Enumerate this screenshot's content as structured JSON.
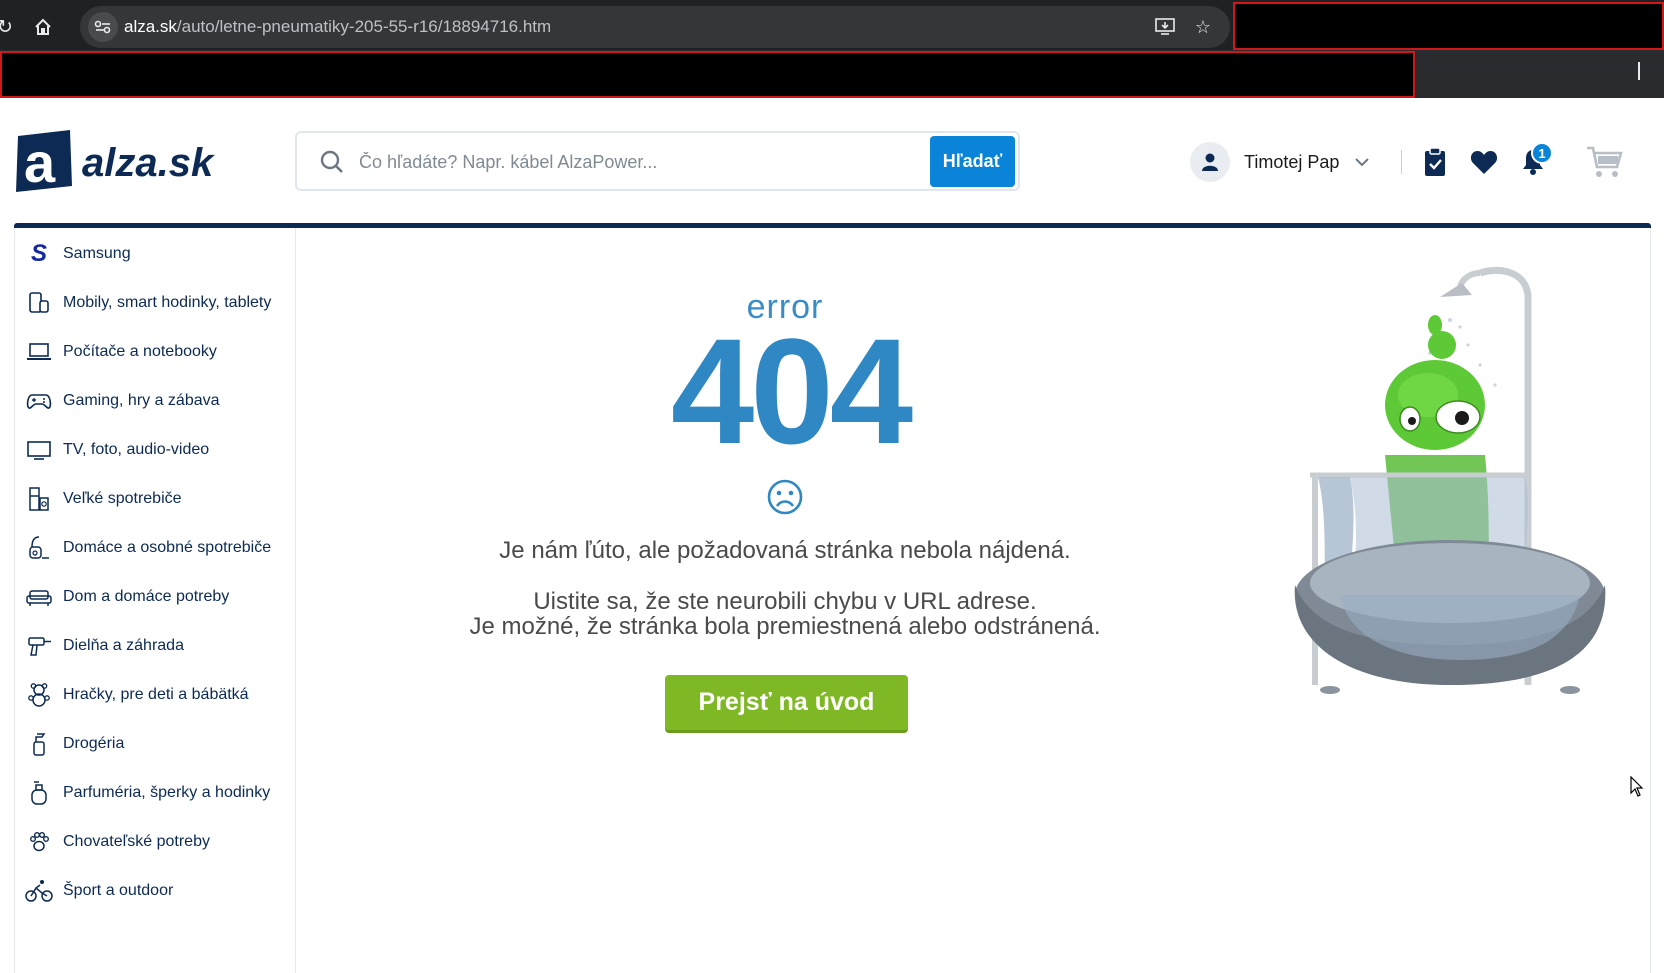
{
  "browser": {
    "url_domain": "alza.sk",
    "url_path": "/auto/letne-pneumatiky-205-55-r16/18894716.htm"
  },
  "header": {
    "logo_text": "alza.sk",
    "search_placeholder": "Čo hľadáte? Napr. kábel AlzaPower...",
    "search_button": "Hľadať",
    "user_name": "Timotej Pap",
    "notifications_count": "1"
  },
  "sidebar": {
    "items": [
      {
        "label": "Samsung",
        "icon": "samsung-icon"
      },
      {
        "label": "Mobily, smart hodinky, tablety",
        "icon": "phone-icon"
      },
      {
        "label": "Počítače a notebooky",
        "icon": "laptop-icon"
      },
      {
        "label": "Gaming, hry a zábava",
        "icon": "gamepad-icon"
      },
      {
        "label": "TV, foto, audio-video",
        "icon": "tv-icon"
      },
      {
        "label": "Veľké spotrebiče",
        "icon": "fridge-icon"
      },
      {
        "label": "Domáce a osobné spotrebiče",
        "icon": "vacuum-icon"
      },
      {
        "label": "Dom a domáce potreby",
        "icon": "sofa-icon"
      },
      {
        "label": "Dielňa a záhrada",
        "icon": "drill-icon"
      },
      {
        "label": "Hračky, pre deti a bábätká",
        "icon": "teddy-icon"
      },
      {
        "label": "Drogéria",
        "icon": "spray-icon"
      },
      {
        "label": "Parfuméria, šperky a hodinky",
        "icon": "perfume-icon"
      },
      {
        "label": "Chovateľské potreby",
        "icon": "paw-icon"
      },
      {
        "label": "Šport a outdoor",
        "icon": "bike-icon"
      }
    ]
  },
  "error": {
    "word": "error",
    "code": "404",
    "message_line1": "Je nám ľúto, ale požadovaná stránka nebola nájdená.",
    "message_line2": "Uistite sa, že ste neurobili chybu v URL adrese.",
    "message_line3": "Je možné, že stránka bola premiestnená alebo odstránená.",
    "home_button": "Prejsť na úvod"
  },
  "colors": {
    "brand_navy": "#0c2a53",
    "accent_blue": "#0a84d8",
    "error_blue": "#2f88c3",
    "button_green": "#7fb825"
  }
}
